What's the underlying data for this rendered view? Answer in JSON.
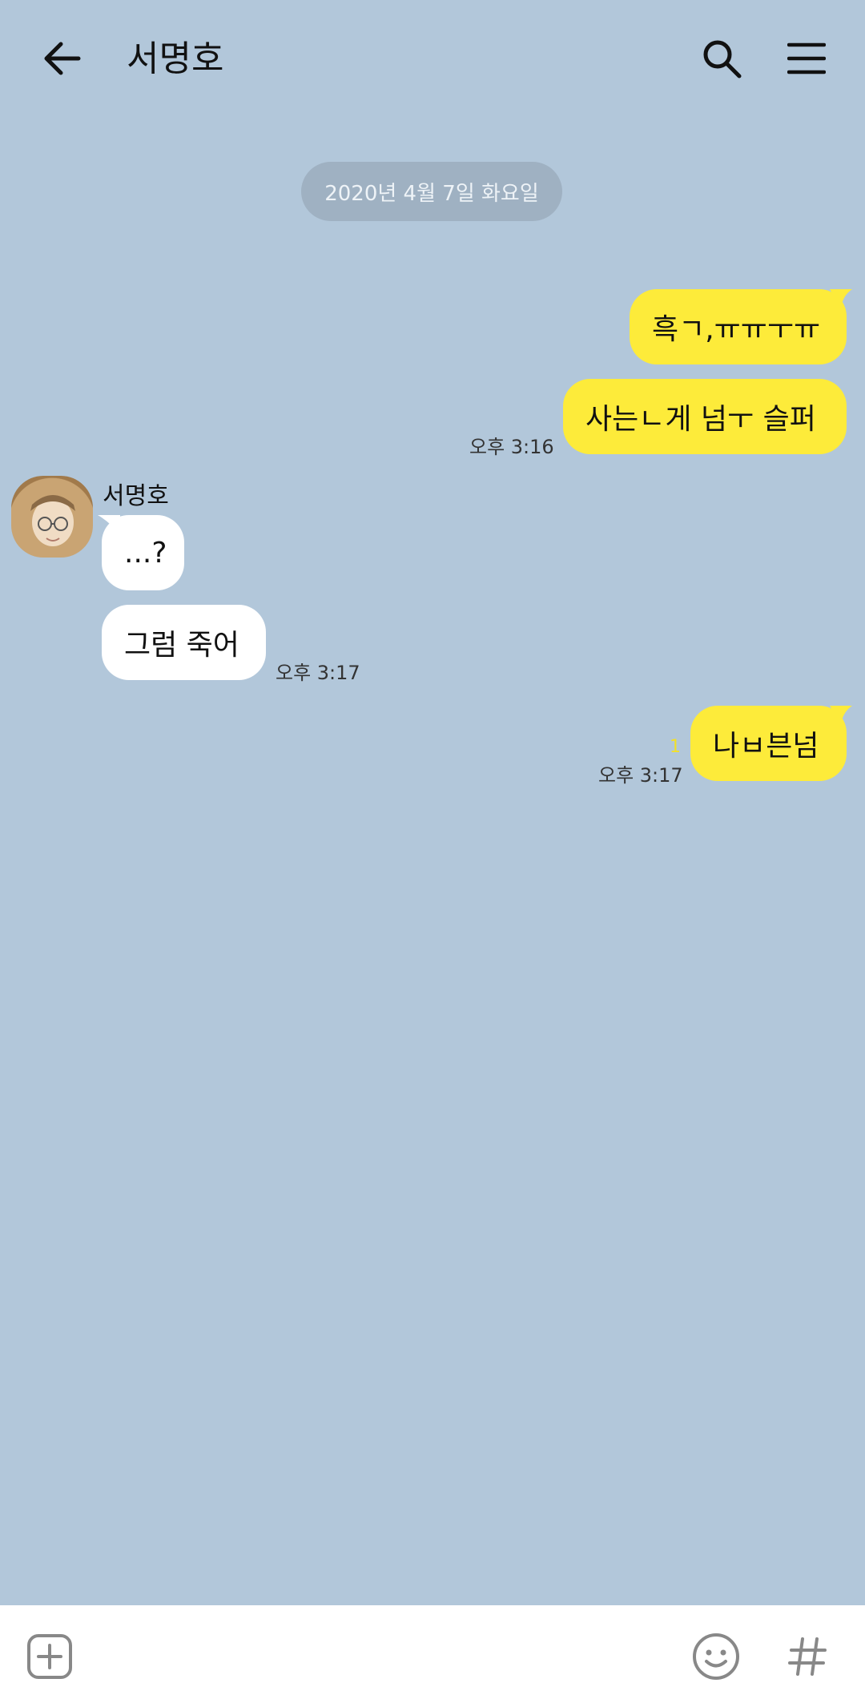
{
  "header": {
    "title": "서명호",
    "back_icon": "arrow-left-icon",
    "search_icon": "search-icon",
    "menu_icon": "hamburger-menu-icon"
  },
  "date_divider": "2020년 4월 7일 화요일",
  "messages": [
    {
      "from": "me",
      "text": "흑ㄱ,ㅠㅠㅜㅠ"
    },
    {
      "from": "me",
      "text": "사는ㄴ게 넘ㅜ 슬퍼",
      "time": "오후 3:16"
    },
    {
      "from": "other",
      "sender": "서명호",
      "text": "...?"
    },
    {
      "from": "other",
      "text": "그럼 죽어",
      "time": "오후 3:17"
    },
    {
      "from": "me",
      "text": "나ㅂ븐넘",
      "time": "오후 3:17",
      "unread": "1"
    }
  ],
  "bottom_bar": {
    "add_icon": "plus-square-icon",
    "emoji_icon": "smiley-icon",
    "hashtag_icon": "hashtag-icon"
  },
  "colors": {
    "background": "#b2c7da",
    "my_bubble": "#fdeb3a",
    "other_bubble": "#ffffff"
  }
}
